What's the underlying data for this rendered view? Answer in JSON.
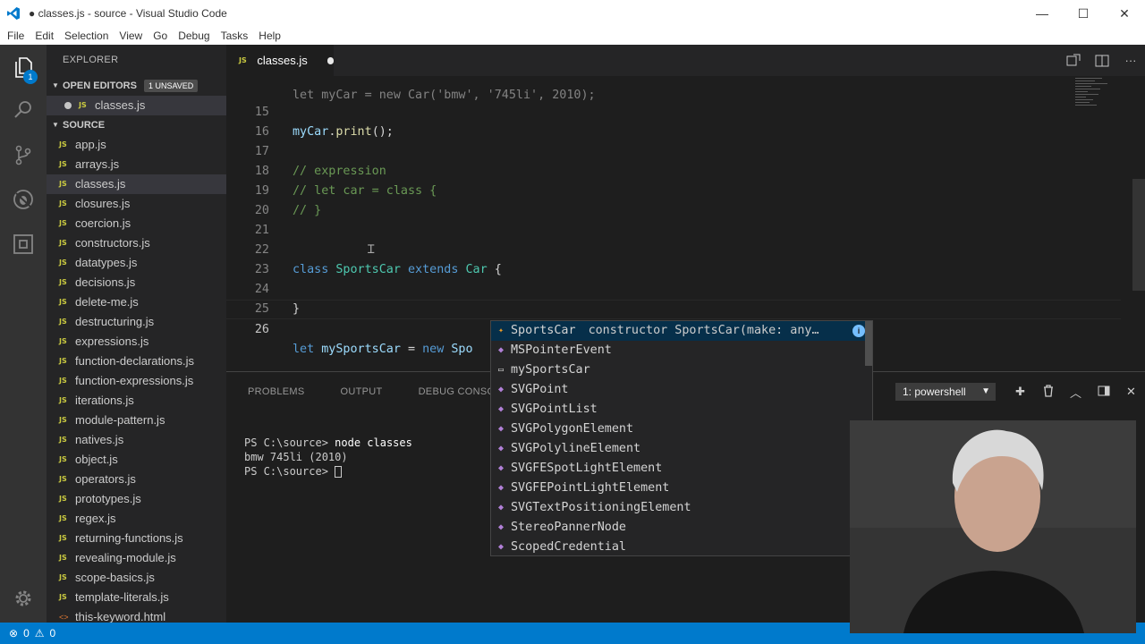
{
  "window": {
    "title": "● classes.js - source - Visual Studio Code",
    "minimize": "—",
    "maximize": "☐",
    "close": "✕"
  },
  "menu": [
    "File",
    "Edit",
    "Selection",
    "View",
    "Go",
    "Debug",
    "Tasks",
    "Help"
  ],
  "activity_bar": {
    "badge": "1",
    "items": [
      "files-icon",
      "search-icon",
      "source-control-icon",
      "debug-icon",
      "extensions-icon",
      "settings-icon"
    ]
  },
  "explorer": {
    "title": "EXPLORER",
    "open_editors": {
      "label": "OPEN EDITORS",
      "badge": "1 UNSAVED",
      "files": [
        "classes.js"
      ]
    },
    "source": {
      "label": "SOURCE",
      "files": [
        "app.js",
        "arrays.js",
        "classes.js",
        "closures.js",
        "coercion.js",
        "constructors.js",
        "datatypes.js",
        "decisions.js",
        "delete-me.js",
        "destructuring.js",
        "expressions.js",
        "function-declarations.js",
        "function-expressions.js",
        "iterations.js",
        "module-pattern.js",
        "natives.js",
        "object.js",
        "operators.js",
        "prototypes.js",
        "regex.js",
        "returning-functions.js",
        "revealing-module.js",
        "scope-basics.js",
        "template-literals.js",
        "this-keyword.html"
      ],
      "selected": "classes.js"
    },
    "file_badge": "JS",
    "html_badge": "<>"
  },
  "tab": {
    "badge": "JS",
    "label": "classes.js"
  },
  "editor": {
    "line_numbers": [
      "15",
      "16",
      "17",
      "18",
      "19",
      "20",
      "21",
      "22",
      "23",
      "24",
      "25",
      "26"
    ],
    "partial_top": "let myCar = new Car('bmw', '745li', 2010);",
    "l15": {
      "obj": "myCar",
      "dot": ".",
      "fn": "print",
      "rest": "();"
    },
    "l17": "// expression",
    "l18": "// let car = class {",
    "l19": "// }",
    "l22": {
      "kw": "class",
      "name": "SportsCar",
      "ext": "extends",
      "base": "Car",
      "brace": "{"
    },
    "l24": "}",
    "l26": {
      "kw": "let",
      "var": "mySportsCar",
      "eq": "=",
      "kw2": "new",
      "typed": "Spo"
    }
  },
  "suggestions": [
    {
      "icon": "class-icon",
      "label": "SportsCar",
      "detail": "constructor SportsCar(make: any…",
      "active": true
    },
    {
      "icon": "variable-icon",
      "label": "MSPointerEvent"
    },
    {
      "icon": "text-icon",
      "label": "mySportsCar"
    },
    {
      "icon": "variable-icon",
      "label": "SVGPoint"
    },
    {
      "icon": "variable-icon",
      "label": "SVGPointList"
    },
    {
      "icon": "variable-icon",
      "label": "SVGPolygonElement"
    },
    {
      "icon": "variable-icon",
      "label": "SVGPolylineElement"
    },
    {
      "icon": "variable-icon",
      "label": "SVGFESpotLightElement"
    },
    {
      "icon": "variable-icon",
      "label": "SVGFEPointLightElement"
    },
    {
      "icon": "variable-icon",
      "label": "SVGTextPositioningElement"
    },
    {
      "icon": "variable-icon",
      "label": "StereoPannerNode"
    },
    {
      "icon": "variable-icon",
      "label": "ScopedCredential"
    }
  ],
  "suggest_info": "i",
  "panel": {
    "tabs": [
      "PROBLEMS",
      "OUTPUT",
      "DEBUG CONSOLE"
    ],
    "terminal_select": "1: powershell",
    "terminal_lines": [
      {
        "prompt": "PS C:\\source> ",
        "cmd": "node classes"
      },
      {
        "prompt": "bmw 745li (2010)",
        "cmd": ""
      },
      {
        "prompt": "PS C:\\source> ",
        "cmd": ""
      }
    ]
  },
  "status": {
    "errors": "0",
    "warnings": "0"
  }
}
